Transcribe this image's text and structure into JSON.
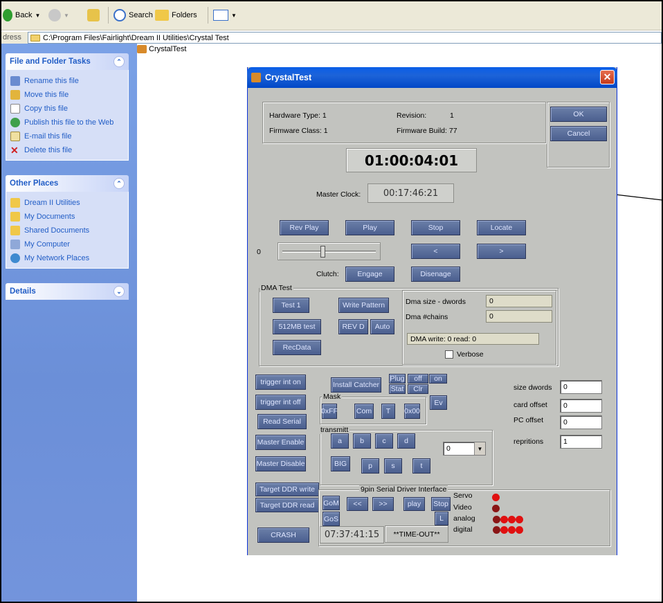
{
  "toolbar": {
    "back": "Back",
    "search": "Search",
    "folders": "Folders"
  },
  "address": {
    "label": "dress",
    "path": "C:\\Program Files\\Fairlight\\Dream II Utilities\\Crystal Test"
  },
  "file_item": "CrystalTest",
  "tasks": {
    "file_folder": {
      "title": "File and Folder Tasks",
      "items": [
        "Rename this file",
        "Move this file",
        "Copy this file",
        "Publish this file to the Web",
        "E-mail this file",
        "Delete this file"
      ]
    },
    "other_places": {
      "title": "Other Places",
      "items": [
        "Dream II Utilities",
        "My Documents",
        "Shared Documents",
        "My Computer",
        "My Network Places"
      ]
    },
    "details": {
      "title": "Details"
    }
  },
  "dialog": {
    "title": "CrystalTest",
    "info": {
      "hw_type": "Hardware Type: 1",
      "fw_class": "Firmware Class: 1",
      "revision_label": "Revision:",
      "revision_value": "1",
      "fw_build": "Firmware Build: 77"
    },
    "ok": "OK",
    "cancel": "Cancel",
    "timecode": "01:00:04:01",
    "master_clock_label": "Master Clock:",
    "master_clock_value": "00:17:46:21",
    "transport": {
      "rev_play": "Rev Play",
      "play": "Play",
      "stop": "Stop",
      "locate": "Locate",
      "prev": "<",
      "next": ">"
    },
    "slider_label": "0",
    "slider_position": 0.42,
    "clutch": {
      "label": "Clutch:",
      "engage": "Engage",
      "disengage": "Disenage"
    },
    "dma": {
      "title": "DMA Test",
      "test1": "Test 1",
      "write_pattern": "Write Pattern",
      "test512": "512MB test",
      "revd": "REV D",
      "auto": "Auto",
      "recdata": "RecData",
      "size_label": "Dma size - dwords",
      "size_value": "0",
      "chains_label": "Dma #chains",
      "chains_value": "0",
      "status": "DMA write: 0 read: 0",
      "verbose": "Verbose"
    },
    "left_buttons": {
      "trigger_on": "trigger int on",
      "trigger_off": "trigger int off",
      "read_serial": "Read Serial",
      "master_enable": "Master Enable",
      "master_disable": "Master Disable",
      "target_write": "Target DDR write",
      "target_read": "Target DDR read",
      "crash": "CRASH"
    },
    "catcher": {
      "install": "Install Catcher",
      "plug": "Plug",
      "off": "off",
      "on": "on",
      "stat": "Stat",
      "clr": "Clr",
      "ev": "Ev"
    },
    "mask": {
      "title": "Mask",
      "xff": "0xFF",
      "com": "Com",
      "t": "T",
      "x00": "0x00"
    },
    "transmit": {
      "title": "transmitt",
      "a": "a",
      "b": "b",
      "c": "c",
      "d": "d",
      "big": "BIG",
      "p": "p",
      "s": "s",
      "t": "t",
      "select_value": "0"
    },
    "params": {
      "size_label": "size dwords",
      "size_value": "0",
      "card_label": "card offset",
      "card_value": "0",
      "pc_label": "PC offset",
      "pc_value": "0",
      "rep_label": "repritions",
      "rep_value": "1"
    },
    "serial": {
      "title": "9pin Serial Driver Interface",
      "gom": "GoM",
      "gos": "GoS",
      "rew": "<<",
      "ff": ">>",
      "play": "play",
      "stop": "Stop",
      "l": "L",
      "time": "07:37:41:15",
      "status": "**TIME-OUT**"
    },
    "leds": {
      "servo": "Servo",
      "video": "Video",
      "analog": "analog",
      "digital": "digital"
    }
  },
  "colors": {
    "xp_blue": "#0a5ee8",
    "button": "#5b6f9c",
    "led_on": "#e01010"
  }
}
